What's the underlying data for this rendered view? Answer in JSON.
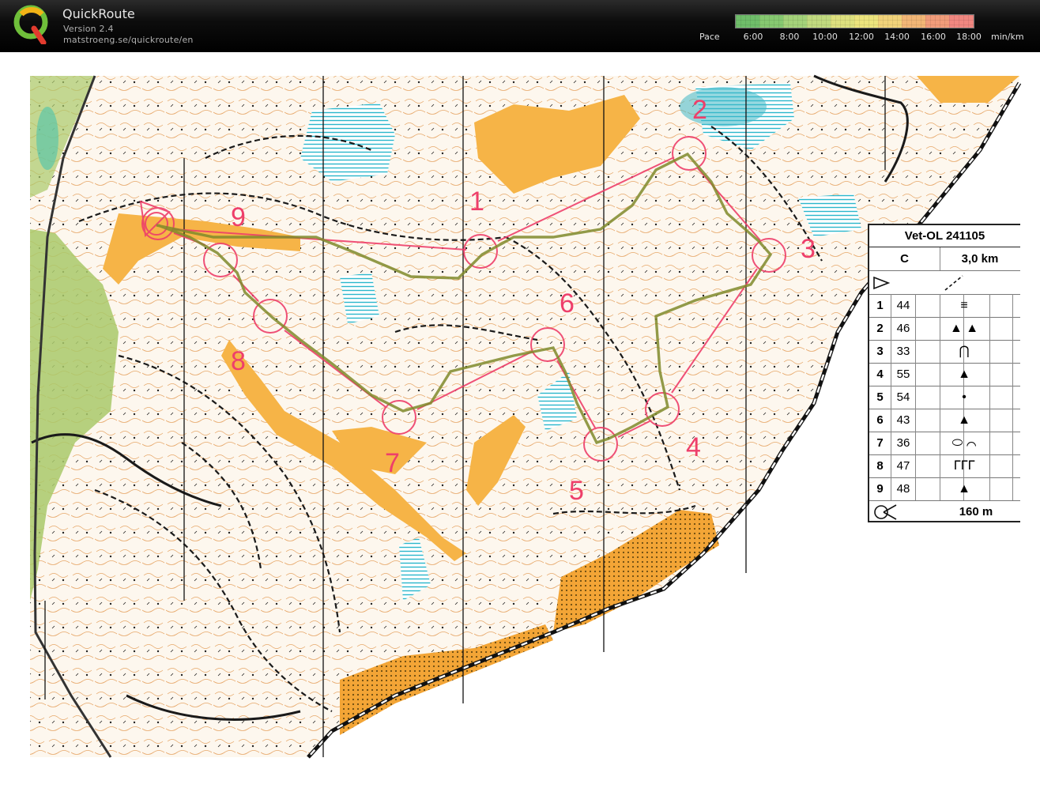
{
  "header": {
    "app_name": "QuickRoute",
    "version": "Version 2.4",
    "url": "matstroeng.se/quickroute/en",
    "pace_label": "Pace",
    "pace_unit": "min/km",
    "pace_ticks": [
      "6:00",
      "8:00",
      "10:00",
      "12:00",
      "14:00",
      "16:00",
      "18:00"
    ],
    "colors": {
      "slow": "#f07a86",
      "fast": "#67b86b",
      "mid": "#e8e070"
    }
  },
  "map": {
    "course_color": "#ee3f6a",
    "control_numbers": [
      "1",
      "2",
      "3",
      "4",
      "5",
      "6",
      "7",
      "8",
      "9"
    ]
  },
  "legend": {
    "event": "Vet-OL 241105",
    "course": "C",
    "length": "3,0 km",
    "controls": [
      {
        "n": "1",
        "code": "44"
      },
      {
        "n": "2",
        "code": "46"
      },
      {
        "n": "3",
        "code": "33"
      },
      {
        "n": "4",
        "code": "55"
      },
      {
        "n": "5",
        "code": "54"
      },
      {
        "n": "6",
        "code": "43"
      },
      {
        "n": "7",
        "code": "36"
      },
      {
        "n": "8",
        "code": "47"
      },
      {
        "n": "9",
        "code": "48"
      }
    ],
    "finish_distance": "160 m"
  }
}
